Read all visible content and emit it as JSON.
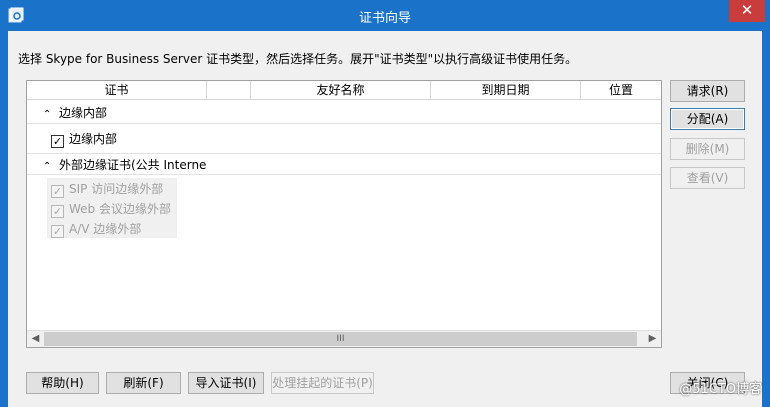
{
  "window": {
    "title": "证书向导",
    "close_glyph": "✕"
  },
  "instruction": "选择 Skype for Business Server 证书类型，然后选择任务。展开\"证书类型\"以执行高级证书使用任务。",
  "table": {
    "columns": [
      "证书",
      "",
      "友好名称",
      "到期日期",
      "位置"
    ],
    "groups": [
      {
        "label": "边缘内部",
        "items": [
          {
            "label": "边缘内部",
            "checked": true,
            "enabled": true
          }
        ]
      },
      {
        "label": "外部边缘证书(公共 Interne",
        "items": [
          {
            "label": "SIP 访问边缘外部",
            "checked": true,
            "enabled": false
          },
          {
            "label": "Web 会议边缘外部",
            "checked": true,
            "enabled": false
          },
          {
            "label": "A/V 边缘外部",
            "checked": true,
            "enabled": false
          }
        ]
      }
    ],
    "scroll_thumb_glyph": "III"
  },
  "side_buttons": {
    "request": "请求(R)",
    "assign": "分配(A)",
    "remove": "删除(M)",
    "view": "查看(V)"
  },
  "bottom_buttons": {
    "help": "帮助(H)",
    "refresh": "刷新(F)",
    "import": "导入证书(I)",
    "process_pending": "处理挂起的证书(P)",
    "close": "关闭(C)"
  },
  "watermark": "@51CTO博客",
  "colors": {
    "titlebar": "#1a73c8",
    "close": "#c83c3c"
  }
}
